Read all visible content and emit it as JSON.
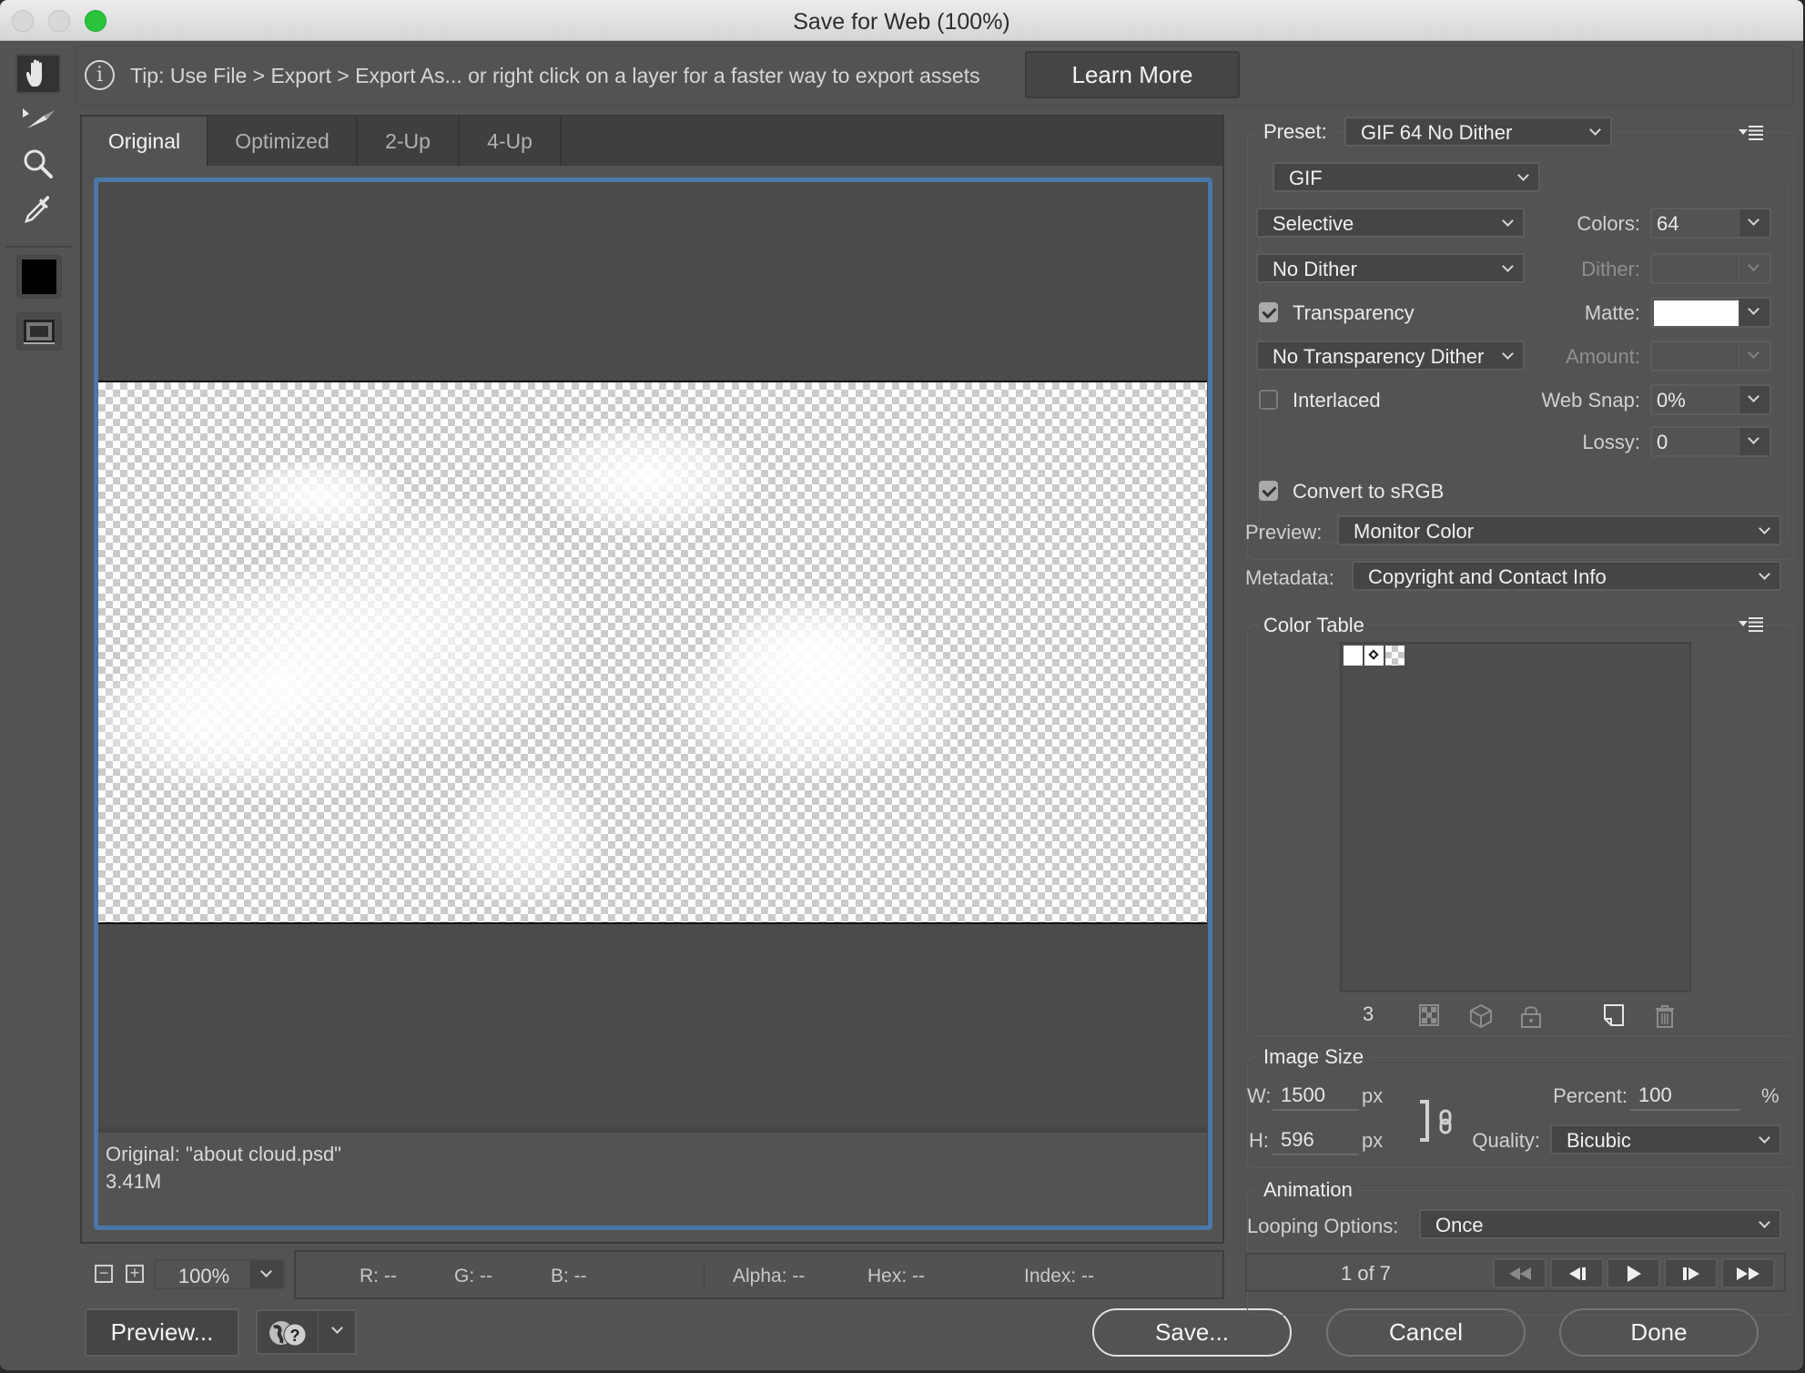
{
  "window": {
    "title": "Save for Web (100%)"
  },
  "toolbar": {
    "tools": [
      {
        "name": "hand-tool",
        "icon": "hand-icon",
        "active": true
      },
      {
        "name": "slice-select-tool",
        "icon": "slice-select-icon",
        "active": false
      },
      {
        "name": "zoom-tool",
        "icon": "magnifier-icon",
        "active": false
      },
      {
        "name": "eyedropper-tool",
        "icon": "eyedropper-icon",
        "active": false
      }
    ],
    "eyedropper_color": "#000000"
  },
  "tip": {
    "text": "Tip: Use File > Export > Export As...  or right click on a layer for a faster way to export assets",
    "learn_more_label": "Learn More"
  },
  "tabs": [
    {
      "label": "Original",
      "active": true
    },
    {
      "label": "Optimized",
      "active": false
    },
    {
      "label": "2-Up",
      "active": false
    },
    {
      "label": "4-Up",
      "active": false
    }
  ],
  "preview_info": {
    "filename_line": "Original: \"about cloud.psd\"",
    "size_line": "3.41M"
  },
  "status": {
    "zoom_value": "100%",
    "r": "R: --",
    "g": "G: --",
    "b": "B: --",
    "alpha": "Alpha: --",
    "hex": "Hex: --",
    "index": "Index: --"
  },
  "buttons": {
    "preview": "Preview...",
    "save": "Save...",
    "cancel": "Cancel",
    "done": "Done"
  },
  "settings": {
    "preset_label": "Preset:",
    "preset_value": "GIF 64 No Dither",
    "format_value": "GIF",
    "reduction_value": "Selective",
    "dither_algo_value": "No Dither",
    "colors_label": "Colors:",
    "colors_value": "64",
    "dither_label": "Dither:",
    "dither_value": "",
    "transparency_label": "Transparency",
    "transparency_checked": true,
    "matte_label": "Matte:",
    "matte_color": "#ffffff",
    "transparency_dither_value": "No Transparency Dither",
    "amount_label": "Amount:",
    "amount_value": "",
    "interlaced_label": "Interlaced",
    "interlaced_checked": false,
    "web_snap_label": "Web Snap:",
    "web_snap_value": "0%",
    "lossy_label": "Lossy:",
    "lossy_value": "0",
    "convert_srgb_label": "Convert to sRGB",
    "convert_srgb_checked": true,
    "preview_label": "Preview:",
    "preview_value": "Monitor Color",
    "metadata_label": "Metadata:",
    "metadata_value": "Copyright and Contact Info"
  },
  "color_table": {
    "title": "Color Table",
    "swatches": [
      "white",
      "white-web-safe-locked",
      "transparent"
    ],
    "count": "3"
  },
  "image_size": {
    "title": "Image Size",
    "w_label": "W:",
    "w_value": "1500",
    "h_label": "H:",
    "h_value": "596",
    "unit": "px",
    "percent_label": "Percent:",
    "percent_value": "100",
    "percent_unit": "%",
    "quality_label": "Quality:",
    "quality_value": "Bicubic"
  },
  "animation": {
    "title": "Animation",
    "looping_label": "Looping Options:",
    "looping_value": "Once",
    "frame_counter": "1 of 7"
  }
}
